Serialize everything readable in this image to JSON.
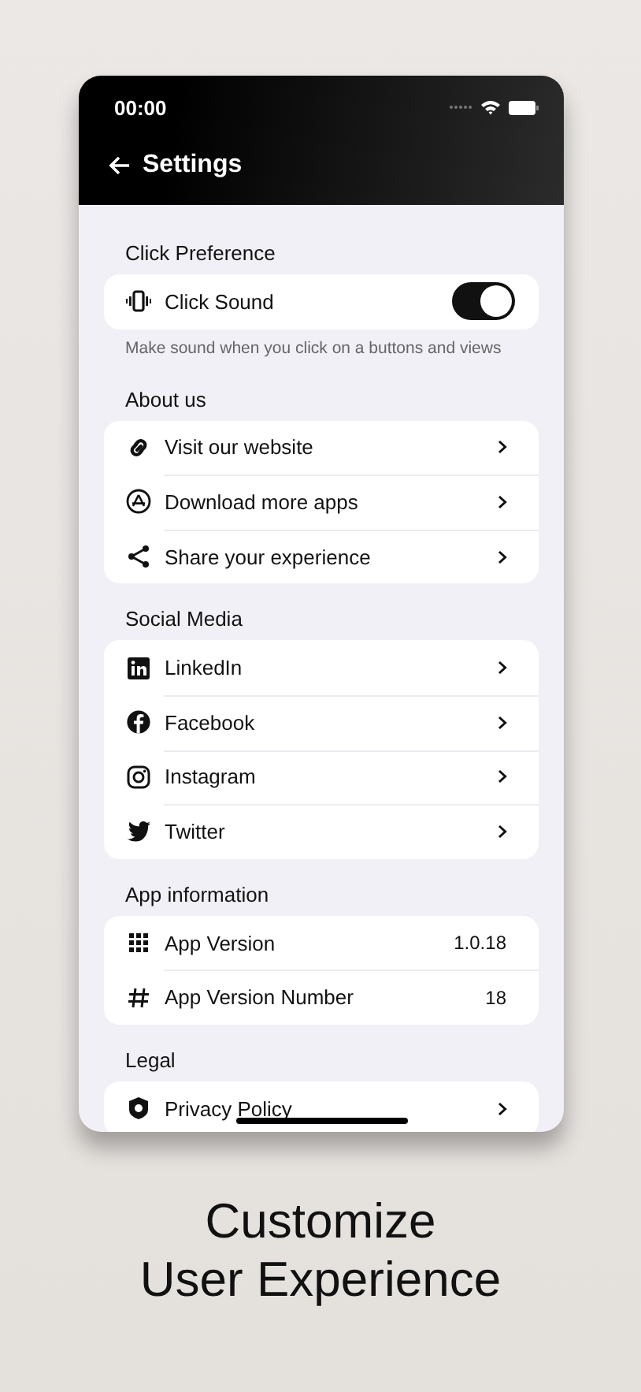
{
  "status_bar": {
    "time": "00:00"
  },
  "header": {
    "title": "Settings"
  },
  "sections": [
    {
      "title": "Click Preference",
      "items": [
        {
          "kind": "toggle",
          "label": "Click Sound",
          "on": true
        }
      ],
      "note": "Make sound when you click on a buttons and views"
    },
    {
      "title": "About us",
      "items": [
        {
          "kind": "link",
          "label": "Visit our website"
        },
        {
          "kind": "link",
          "label": "Download more apps"
        },
        {
          "kind": "link",
          "label": "Share your experience"
        }
      ]
    },
    {
      "title": "Social Media",
      "items": [
        {
          "kind": "link",
          "label": "LinkedIn"
        },
        {
          "kind": "link",
          "label": "Facebook"
        },
        {
          "kind": "link",
          "label": "Instagram"
        },
        {
          "kind": "link",
          "label": "Twitter"
        }
      ]
    },
    {
      "title": "App information",
      "items": [
        {
          "kind": "value",
          "label": "App Version",
          "value": "1.0.18"
        },
        {
          "kind": "value",
          "label": "App Version Number",
          "value": "18"
        }
      ]
    },
    {
      "title": "Legal",
      "items": [
        {
          "kind": "link",
          "label": "Privacy Policy"
        }
      ]
    }
  ],
  "caption": [
    "Customize",
    "User Experience"
  ]
}
